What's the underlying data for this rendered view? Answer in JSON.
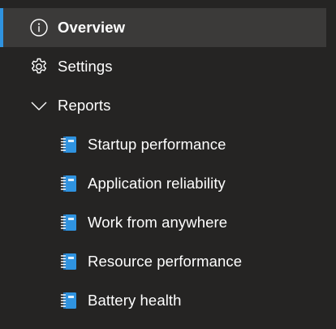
{
  "nav": {
    "overview": {
      "label": "Overview",
      "icon": "info-icon",
      "active": true
    },
    "settings": {
      "label": "Settings",
      "icon": "gear-icon"
    },
    "reports": {
      "label": "Reports",
      "icon": "chevron-down-icon",
      "expanded": true,
      "items": [
        {
          "label": "Startup performance",
          "icon": "report-notebook-icon"
        },
        {
          "label": "Application reliability",
          "icon": "report-notebook-icon"
        },
        {
          "label": "Work from anywhere",
          "icon": "report-notebook-icon"
        },
        {
          "label": "Resource performance",
          "icon": "report-notebook-icon"
        },
        {
          "label": "Battery health",
          "icon": "report-notebook-icon"
        }
      ]
    }
  },
  "colors": {
    "background": "#252423",
    "active_background": "#3b3a39",
    "active_indicator": "#2f93e0",
    "text": "#ffffff",
    "report_icon": "#2f93e0"
  }
}
